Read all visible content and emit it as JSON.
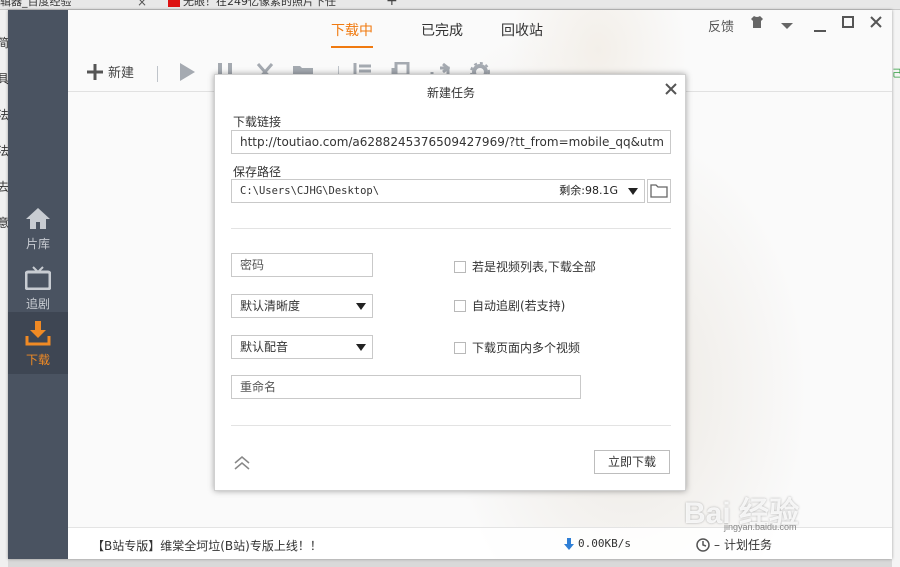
{
  "browser": {
    "tab1": "辑器_百度经验",
    "tab2": "无眼！在249亿像素的照片下任",
    "tab_close": "×",
    "tab_plus": "+",
    "left_chars": [
      "简",
      "具",
      "法",
      "法",
      "去",
      "意"
    ],
    "right_char": "己"
  },
  "sidebar": {
    "items": [
      {
        "label": "片库",
        "icon": "home-icon"
      },
      {
        "label": "追剧",
        "icon": "tv-icon"
      },
      {
        "label": "下载",
        "icon": "download-icon",
        "active": true
      }
    ]
  },
  "tabs": [
    {
      "label": "下载中",
      "active": true
    },
    {
      "label": "已完成"
    },
    {
      "label": "回收站"
    }
  ],
  "window": {
    "feedback": "反馈",
    "controls": [
      "skin-icon",
      "menu-arrow-icon",
      "minimize-icon",
      "maximize-icon",
      "close-icon"
    ]
  },
  "toolbar": {
    "new_label": "新建",
    "buttons": [
      "play-icon",
      "pause-icon",
      "delete-icon",
      "folder-icon",
      "list-icon",
      "copy-icon",
      "share-icon",
      "settings-icon"
    ]
  },
  "dialog": {
    "title": "新建任务",
    "url_label": "下载链接",
    "url_value": "http://toutiao.com/a6288245376509427969/?tt_from=mobile_qq&utm",
    "path_label": "保存路径",
    "path_value": "C:\\Users\\CJHG\\Desktop\\",
    "free_space": "剩余:98.1G",
    "password_placeholder": "密码",
    "quality_value": "默认清晰度",
    "audio_value": "默认配音",
    "rename_placeholder": "重命名",
    "checkboxes": [
      {
        "label": "若是视频列表,下载全部",
        "checked": false
      },
      {
        "label": "自动追剧(若支持)",
        "checked": false
      },
      {
        "label": "下载页面内多个视频",
        "checked": false
      }
    ],
    "download_button": "立即下载"
  },
  "status": {
    "notice": "【B站专版】维棠全坷垃(B站)专版上线！！",
    "speed": "0.00KB/s",
    "schedule": "计划任务"
  },
  "watermark": {
    "text": "Bai 经验",
    "sub": "jingyan.baidu.com"
  },
  "colors": {
    "accent": "#f07a10",
    "sidebar": "#4a5361",
    "download_arrow": "#2f7fd6"
  }
}
